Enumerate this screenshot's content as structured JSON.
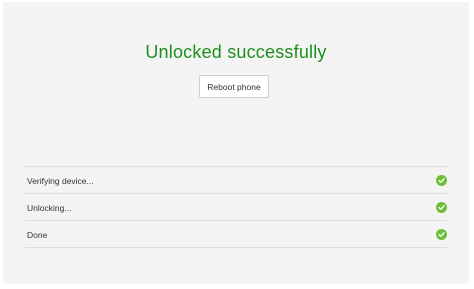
{
  "status": {
    "title": "Unlocked successfully",
    "title_color": "#1d8f1d"
  },
  "actions": {
    "reboot_label": "Reboot phone"
  },
  "steps": [
    {
      "label": "Verifying device...",
      "icon": "check-circle-icon",
      "state": "done"
    },
    {
      "label": "Unlocking...",
      "icon": "check-circle-icon",
      "state": "done"
    },
    {
      "label": "Done",
      "icon": "check-circle-icon",
      "state": "done"
    }
  ],
  "colors": {
    "success": "#6cbf3a"
  }
}
